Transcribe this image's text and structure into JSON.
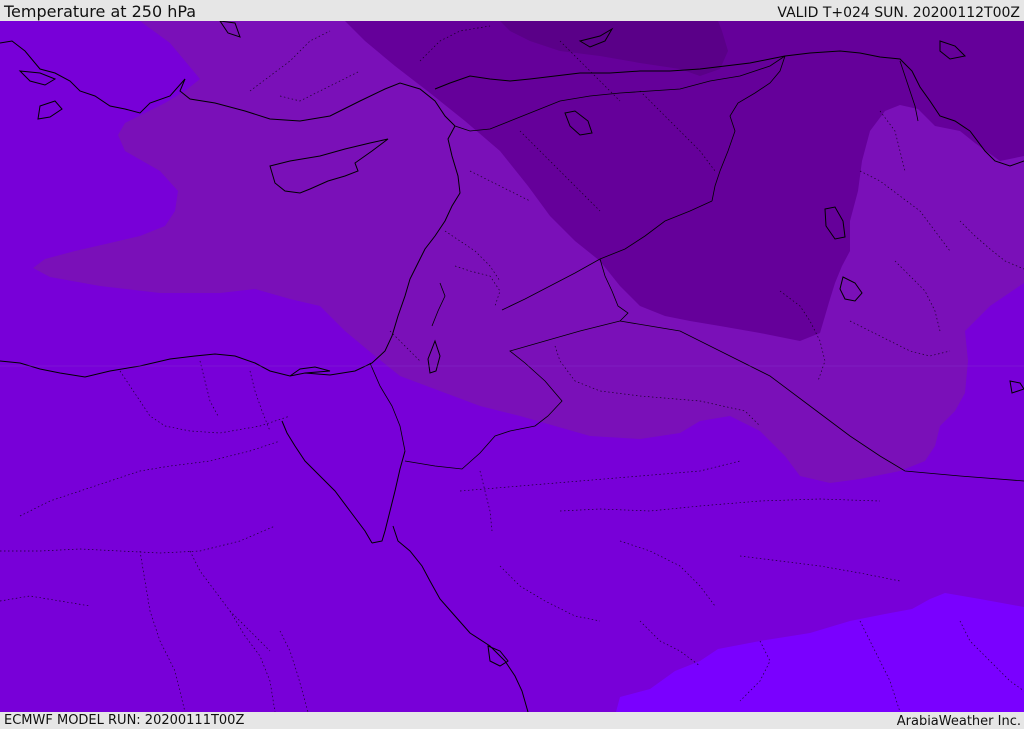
{
  "header": {
    "title": "Temperature at 250 hPa",
    "valid_time": "VALID T+024 SUN. 20200112T00Z"
  },
  "footer": {
    "model_run": "ECMWF MODEL RUN: 20200111T00Z",
    "credit": "ArabiaWeather Inc."
  },
  "map": {
    "field": "temperature-250hpa",
    "colors": {
      "band_base": "#7800d8",
      "band_warm": "#7a00ff",
      "band_cool": "#7a10b8",
      "band_cold": "#65009a",
      "band_coldest": "#5a0088",
      "coastline": "#000000",
      "border": "#000000"
    }
  }
}
